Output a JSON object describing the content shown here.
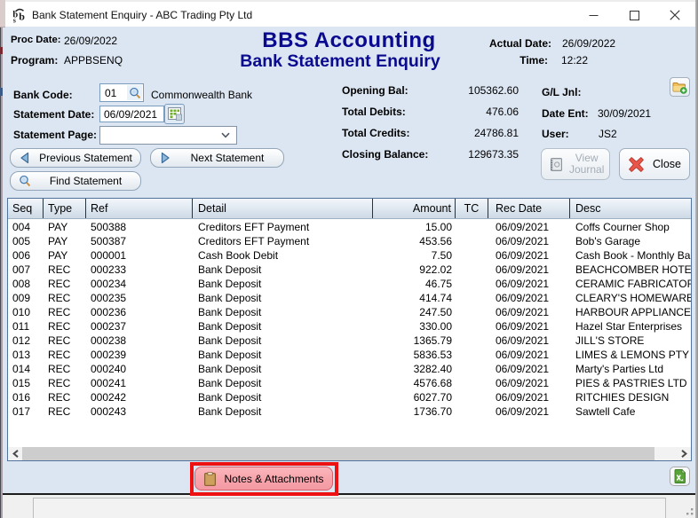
{
  "window": {
    "title": "Bank Statement Enquiry - ABC Trading Pty Ltd"
  },
  "header": {
    "proc_date_label": "Proc Date:",
    "proc_date": "26/09/2022",
    "program_label": "Program:",
    "program": "APPBSENQ",
    "app_title": "BBS Accounting",
    "screen_title": "Bank Statement Enquiry",
    "actual_date_label": "Actual Date:",
    "actual_date": "26/09/2022",
    "time_label": "Time:",
    "time": "12:22"
  },
  "form": {
    "bank_code_label": "Bank Code:",
    "bank_code": "01",
    "bank_name": "Commonwealth Bank",
    "statement_date_label": "Statement Date:",
    "statement_date": "06/09/2021",
    "statement_page_label": "Statement Page:",
    "statement_page": "",
    "previous_button": "Previous Statement",
    "next_button": "Next Statement",
    "find_button": "Find Statement"
  },
  "summary": {
    "opening_bal_label": "Opening Bal:",
    "opening_bal": "105362.60",
    "total_debits_label": "Total Debits:",
    "total_debits": "476.06",
    "total_credits_label": "Total Credits:",
    "total_credits": "24786.81",
    "closing_balance_label": "Closing Balance:",
    "closing_balance": "129673.35"
  },
  "journal": {
    "gl_jnl_label": "G/L Jnl:",
    "date_ent_label": "Date Ent:",
    "date_ent": "30/09/2021",
    "user_label": "User:",
    "user": "JS2",
    "view_journal_button": "View Journal",
    "close_button": "Close"
  },
  "table": {
    "columns": [
      "Seq",
      "Type",
      "Ref",
      "Detail",
      "Amount",
      "TC",
      "Rec Date",
      "Desc"
    ],
    "rows": [
      [
        "004",
        "PAY",
        "500388",
        "Creditors EFT Payment",
        "15.00",
        "",
        "06/09/2021",
        "Coffs Courner Shop"
      ],
      [
        "005",
        "PAY",
        "500387",
        "Creditors EFT Payment",
        "453.56",
        "",
        "06/09/2021",
        "Bob's Garage"
      ],
      [
        "006",
        "PAY",
        "000001",
        "Cash Book Debit",
        "7.50",
        "",
        "06/09/2021",
        "Cash Book - Monthly Bank Fees"
      ],
      [
        "007",
        "REC",
        "000233",
        "Bank Deposit",
        "922.02",
        "",
        "06/09/2021",
        "BEACHCOMBER HOTEL"
      ],
      [
        "008",
        "REC",
        "000234",
        "Bank Deposit",
        "46.75",
        "",
        "06/09/2021",
        "CERAMIC FABRICATORS"
      ],
      [
        "009",
        "REC",
        "000235",
        "Bank Deposit",
        "414.74",
        "",
        "06/09/2021",
        "CLEARY'S HOMEWARES"
      ],
      [
        "010",
        "REC",
        "000236",
        "Bank Deposit",
        "247.50",
        "",
        "06/09/2021",
        "HARBOUR APPLIANCES"
      ],
      [
        "011",
        "REC",
        "000237",
        "Bank Deposit",
        "330.00",
        "",
        "06/09/2021",
        "Hazel Star Enterprises"
      ],
      [
        "012",
        "REC",
        "000238",
        "Bank Deposit",
        "1365.79",
        "",
        "06/09/2021",
        "JILL'S STORE"
      ],
      [
        "013",
        "REC",
        "000239",
        "Bank Deposit",
        "5836.53",
        "",
        "06/09/2021",
        "LIMES & LEMONS PTY LTD"
      ],
      [
        "014",
        "REC",
        "000240",
        "Bank Deposit",
        "3282.40",
        "",
        "06/09/2021",
        "Marty's Parties Ltd"
      ],
      [
        "015",
        "REC",
        "000241",
        "Bank Deposit",
        "4576.68",
        "",
        "06/09/2021",
        "PIES & PASTRIES LTD"
      ],
      [
        "016",
        "REC",
        "000242",
        "Bank Deposit",
        "6027.70",
        "",
        "06/09/2021",
        "RITCHIES DESIGN"
      ],
      [
        "017",
        "REC",
        "000243",
        "Bank Deposit",
        "1736.70",
        "",
        "06/09/2021",
        "Sawtell Cafe"
      ]
    ]
  },
  "footer": {
    "notes_button": "Notes & Attachments"
  },
  "colors": {
    "body_bg": "#dce6f2",
    "title_navy": "#0a0a90",
    "highlight_red": "#ee1111",
    "notes_pink": "#f7a3ab",
    "grid_border": "#52749c"
  }
}
